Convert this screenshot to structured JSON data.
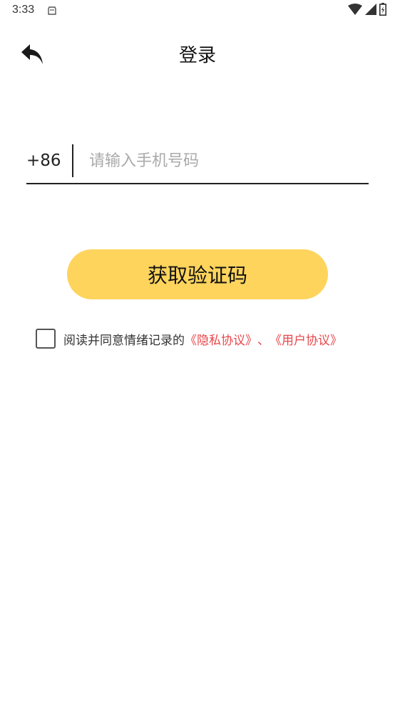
{
  "status_bar": {
    "time": "3:33",
    "icons": [
      "notification-icon",
      "wifi-icon",
      "signal-icon",
      "battery-icon"
    ]
  },
  "header": {
    "title": "登录",
    "back_icon": "back-arrow-icon"
  },
  "phone": {
    "country_code": "+86",
    "value": "",
    "placeholder": "请输入手机号码"
  },
  "get_code_button": {
    "label": "获取验证码"
  },
  "agreement": {
    "checked": false,
    "text": "阅读并同意情绪记录的",
    "privacy_link": "《隐私协议》",
    "separator": "、",
    "user_link": "《用户协议》"
  },
  "colors": {
    "accent": "#fed45d",
    "link": "#e8474a",
    "text": "#111111",
    "placeholder": "#aaaaaa"
  }
}
